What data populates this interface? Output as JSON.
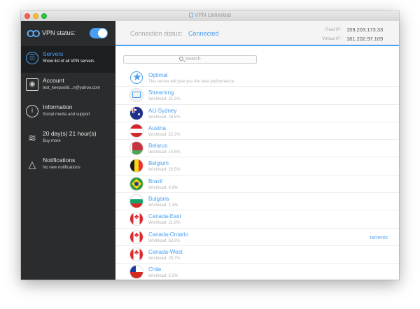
{
  "window": {
    "title": "VPN Unlimited"
  },
  "sidebar": {
    "vpn_status_label": "VPN status:",
    "vpn_enabled": true,
    "items": [
      {
        "title": "Servers",
        "subtitle": "Show list of all VPN servers",
        "icon": "list-icon",
        "active": true
      },
      {
        "title": "Account",
        "subtitle": "test_keepsolid...n@yahoo.com",
        "icon": "account-icon",
        "active": false
      },
      {
        "title": "Information",
        "subtitle": "Social media and support",
        "icon": "info-icon",
        "active": false
      },
      {
        "title": "20 day(s) 21 hour(s)",
        "subtitle": "Buy more",
        "icon": "coins-icon",
        "active": false
      },
      {
        "title": "Notifications",
        "subtitle": "No new notifications",
        "icon": "bell-icon",
        "active": false
      }
    ]
  },
  "topbar": {
    "connection_label": "Connection status:",
    "connection_value": "Connected",
    "real_ip_label": "Real IP:",
    "real_ip": "159.203.173.33",
    "virtual_ip_label": "Virtual IP:",
    "virtual_ip": "161.202.97.109"
  },
  "search": {
    "placeholder": "Search"
  },
  "servers": [
    {
      "name": "Optimal",
      "subtitle": "This server will give you the best performance.",
      "flag": "optimal",
      "tag": ""
    },
    {
      "name": "Streaming",
      "subtitle": "Workload: 21.5%",
      "flag": "streaming",
      "tag": ""
    },
    {
      "name": "AU-Sydney",
      "subtitle": "Workload: 29.5%",
      "flag": "australia",
      "tag": ""
    },
    {
      "name": "Austria",
      "subtitle": "Workload: 22.2%",
      "flag": "austria",
      "tag": ""
    },
    {
      "name": "Belarus",
      "subtitle": "Workload: 14.8%",
      "flag": "belarus",
      "tag": ""
    },
    {
      "name": "Belgium",
      "subtitle": "Workload: 20.5%",
      "flag": "belgium",
      "tag": ""
    },
    {
      "name": "Brazil",
      "subtitle": "Workload: 4.9%",
      "flag": "brazil",
      "tag": ""
    },
    {
      "name": "Bulgaria",
      "subtitle": "Workload: 1.4%",
      "flag": "bulgaria",
      "tag": ""
    },
    {
      "name": "Canada-East",
      "subtitle": "Workload: 21.8%",
      "flag": "canada",
      "tag": ""
    },
    {
      "name": "Canada-Ontario",
      "subtitle": "Workload: 63.6%",
      "flag": "canada",
      "tag": "torrents"
    },
    {
      "name": "Canada-West",
      "subtitle": "Workload: 28.7%",
      "flag": "canada",
      "tag": ""
    },
    {
      "name": "Chile",
      "subtitle": "Workload: 5.5%",
      "flag": "chile",
      "tag": ""
    }
  ],
  "colors": {
    "accent": "#4a9ff0",
    "sidebar_bg": "#2b2c2d",
    "sidebar_active_bg": "#1d1e1f"
  }
}
